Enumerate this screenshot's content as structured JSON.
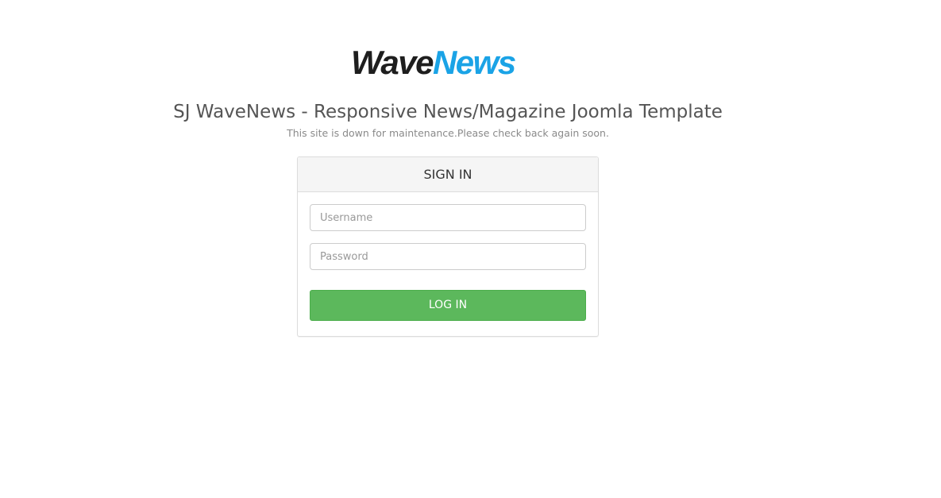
{
  "logo": {
    "part1": "Wave",
    "part2": "News",
    "colors": {
      "part1": "#1e1e1e",
      "part2": "#1aa3e6"
    }
  },
  "site": {
    "title": "SJ WaveNews - Responsive News/Magazine Joomla Template",
    "message": "This site is down for maintenance.Please check back again soon."
  },
  "login": {
    "heading": "SIGN IN",
    "username_placeholder": "Username",
    "password_placeholder": "Password",
    "button_label": "LOG IN",
    "button_color": "#5cb85c"
  }
}
